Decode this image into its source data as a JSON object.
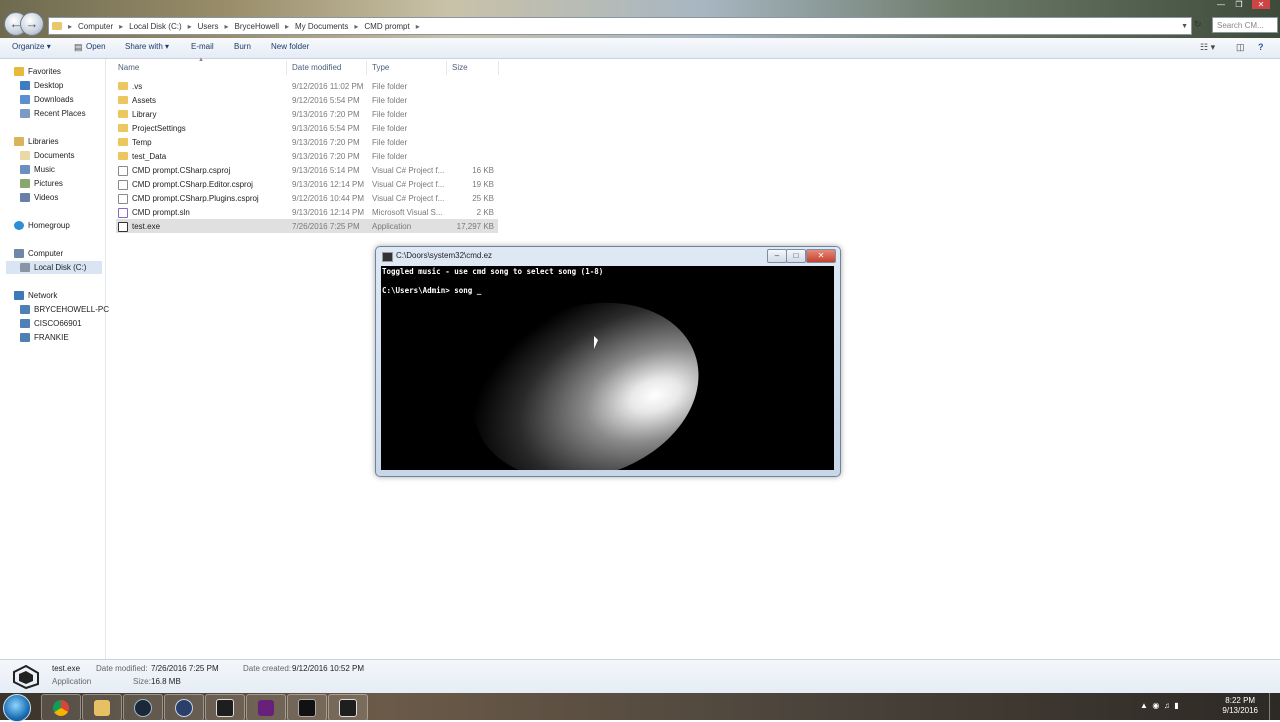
{
  "explorer": {
    "breadcrumbs": [
      "Computer",
      "Local Disk (C:)",
      "Users",
      "BryceHowell",
      "My Documents",
      "CMD prompt"
    ],
    "search_placeholder": "Search CM...",
    "toolbar": {
      "organize": "Organize",
      "open": "Open",
      "share_with": "Share with",
      "email": "E-mail",
      "burn": "Burn",
      "new_folder": "New folder"
    },
    "nav": {
      "favorites": "Favorites",
      "desktop": "Desktop",
      "downloads": "Downloads",
      "recent": "Recent Places",
      "libraries": "Libraries",
      "documents": "Documents",
      "music": "Music",
      "pictures": "Pictures",
      "videos": "Videos",
      "homegroup": "Homegroup",
      "computer": "Computer",
      "local_disk": "Local Disk (C:)",
      "network": "Network",
      "pc1": "BRYCEHOWELL-PC",
      "pc2": "CISCO66901",
      "pc3": "FRANKIE"
    },
    "columns": {
      "name": "Name",
      "date": "Date modified",
      "type": "Type",
      "size": "Size"
    },
    "files": [
      {
        "name": ".vs",
        "date": "9/12/2016 11:02 PM",
        "type": "File folder",
        "size": "",
        "icon": "folder"
      },
      {
        "name": "Assets",
        "date": "9/12/2016 5:54 PM",
        "type": "File folder",
        "size": "",
        "icon": "folder"
      },
      {
        "name": "Library",
        "date": "9/13/2016 7:20 PM",
        "type": "File folder",
        "size": "",
        "icon": "folder"
      },
      {
        "name": "ProjectSettings",
        "date": "9/13/2016 5:54 PM",
        "type": "File folder",
        "size": "",
        "icon": "folder"
      },
      {
        "name": "Temp",
        "date": "9/13/2016 7:20 PM",
        "type": "File folder",
        "size": "",
        "icon": "folder"
      },
      {
        "name": "test_Data",
        "date": "9/13/2016 7:20 PM",
        "type": "File folder",
        "size": "",
        "icon": "folder"
      },
      {
        "name": "CMD prompt.CSharp.csproj",
        "date": "9/13/2016 5:14 PM",
        "type": "Visual C# Project f...",
        "size": "16 KB",
        "icon": "proj"
      },
      {
        "name": "CMD prompt.CSharp.Editor.csproj",
        "date": "9/13/2016 12:14 PM",
        "type": "Visual C# Project f...",
        "size": "19 KB",
        "icon": "proj"
      },
      {
        "name": "CMD prompt.CSharp.Plugins.csproj",
        "date": "9/12/2016 10:44 PM",
        "type": "Visual C# Project f...",
        "size": "25 KB",
        "icon": "proj"
      },
      {
        "name": "CMD prompt.sln",
        "date": "9/13/2016 12:14 PM",
        "type": "Microsoft Visual S...",
        "size": "2 KB",
        "icon": "sln"
      },
      {
        "name": "test.exe",
        "date": "7/26/2016 7:25 PM",
        "type": "Application",
        "size": "17,297 KB",
        "icon": "exe"
      }
    ],
    "details": {
      "filename": "test.exe",
      "kind": "Application",
      "modified_label": "Date modified:",
      "modified_value": "7/26/2016 7:25 PM",
      "created_label": "Date created:",
      "created_value": "9/12/2016 10:52 PM",
      "size_label": "Size:",
      "size_value": "16.8 MB"
    }
  },
  "console": {
    "title": "C:\\Doors\\system32\\cmd.ez",
    "line1": "Toggled music - use cmd song to select song (1-8)",
    "line2": "C:\\Users\\Admin> song _"
  },
  "taskbar": {
    "time": "8:22 PM",
    "date": "9/13/2016"
  }
}
